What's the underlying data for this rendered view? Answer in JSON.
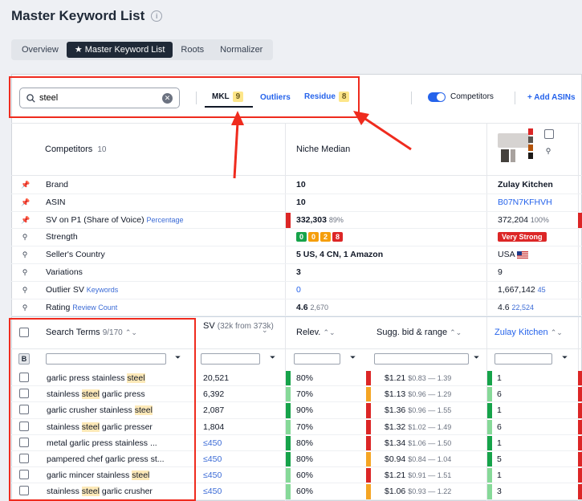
{
  "page": {
    "title": "Master Keyword List"
  },
  "tabs": [
    {
      "label": "Overview",
      "active": false
    },
    {
      "label": "Master Keyword List",
      "active": true
    },
    {
      "label": "Roots",
      "active": false
    },
    {
      "label": "Normalizer",
      "active": false
    }
  ],
  "toolbar": {
    "search_value": "steel",
    "segments": [
      {
        "label": "MKL",
        "count": "9"
      },
      {
        "label": "Outliers",
        "count": ""
      },
      {
        "label": "Residue",
        "count": "8"
      }
    ],
    "competitors_label": "Competitors",
    "competitors_on": true,
    "add_asins": "+ Add ASINs"
  },
  "competitors_header": {
    "label": "Competitors",
    "count": "10"
  },
  "niche_header": "Niche Median",
  "product": {
    "name": "Zulay Kitchen",
    "asin": "B07N7KFHVH"
  },
  "attributes": [
    {
      "label": "Brand",
      "sub": "",
      "niche": "10",
      "niche_sub": "",
      "product": "Zulay Kitchen",
      "product_sub": ""
    },
    {
      "label": "ASIN",
      "sub": "",
      "niche": "10",
      "niche_sub": "",
      "product": "B07N7KFHVH",
      "product_sub": ""
    },
    {
      "label": "SV on P1 (Share of Voice)",
      "sub": "Percentage",
      "niche": "332,303",
      "niche_sub": "89%",
      "product": "372,204",
      "product_sub": "100%"
    },
    {
      "label": "Strength",
      "sub": "",
      "niche": "",
      "niche_sub": "",
      "product": "Very Strong",
      "product_sub": ""
    },
    {
      "label": "Seller's Country",
      "sub": "",
      "niche": "5 US, 4 CN, 1 Amazon",
      "niche_sub": "",
      "product": "USA",
      "product_sub": ""
    },
    {
      "label": "Variations",
      "sub": "",
      "niche": "3",
      "niche_sub": "",
      "product": "9",
      "product_sub": ""
    },
    {
      "label": "Outlier SV",
      "sub": "Keywords",
      "niche": "0",
      "niche_sub": "",
      "product": "1,667,142",
      "product_sub": "45"
    },
    {
      "label": "Rating",
      "sub": "Review Count",
      "niche": "4.6",
      "niche_sub": "2,670",
      "product": "4.6",
      "product_sub": "22,524"
    }
  ],
  "strength_chips": [
    {
      "value": "0",
      "color": "#16a34a"
    },
    {
      "value": "0",
      "color": "#f59e0b"
    },
    {
      "value": "2",
      "color": "#f59e0b"
    },
    {
      "value": "8",
      "color": "#dc2626"
    }
  ],
  "table_header": {
    "search_terms": "Search Terms",
    "search_terms_count": "9/170",
    "sv": "SV",
    "sv_sub": "(32k from 373k)",
    "relev": "Relev.",
    "bid": "Sugg. bid & range",
    "product_col": "Zulay Kitchen",
    "b_label": "B"
  },
  "keywords": [
    {
      "pre": "garlic press stainless ",
      "hl": "steel",
      "post": "",
      "sv": "20,521",
      "relev": "80%",
      "bid": "$1.21",
      "range": "$0.83 — 1.39",
      "rank": "1",
      "relevColor": "#16a34a",
      "bidColor": "#dc2626",
      "rankColor": "#dc2626"
    },
    {
      "pre": "stainless ",
      "hl": "steel",
      "post": " garlic press",
      "sv": "6,392",
      "relev": "70%",
      "bid": "$1.13",
      "range": "$0.96 — 1.29",
      "rank": "6",
      "relevColor": "#86d998",
      "bidColor": "#f5a524",
      "rankColor": "#dc2626"
    },
    {
      "pre": "garlic crusher stainless ",
      "hl": "steel",
      "post": "",
      "sv": "2,087",
      "relev": "90%",
      "bid": "$1.36",
      "range": "$0.96 — 1.55",
      "rank": "1",
      "relevColor": "#16a34a",
      "bidColor": "#dc2626",
      "rankColor": "#dc2626"
    },
    {
      "pre": "stainless ",
      "hl": "steel",
      "post": " garlic presser",
      "sv": "1,804",
      "relev": "70%",
      "bid": "$1.32",
      "range": "$1.02 — 1.49",
      "rank": "6",
      "relevColor": "#86d998",
      "bidColor": "#dc2626",
      "rankColor": "#dc2626"
    },
    {
      "pre": "metal garlic press stainless ...",
      "hl": "",
      "post": "",
      "sv": "≤450",
      "relev": "80%",
      "bid": "$1.34",
      "range": "$1.06 — 1.50",
      "rank": "1",
      "relevColor": "#16a34a",
      "bidColor": "#dc2626",
      "rankColor": "#dc2626"
    },
    {
      "pre": "pampered chef garlic press st...",
      "hl": "",
      "post": "",
      "sv": "≤450",
      "relev": "80%",
      "bid": "$0.94",
      "range": "$0.84 — 1.04",
      "rank": "5",
      "relevColor": "#16a34a",
      "bidColor": "#f5a524",
      "rankColor": "#dc2626"
    },
    {
      "pre": "garlic mincer stainless ",
      "hl": "steel",
      "post": "",
      "sv": "≤450",
      "relev": "60%",
      "bid": "$1.21",
      "range": "$0.91 — 1.51",
      "rank": "1",
      "relevColor": "#86d998",
      "bidColor": "#dc2626",
      "rankColor": "#dc2626"
    },
    {
      "pre": "stainless ",
      "hl": "steel",
      "post": " garlic crusher",
      "sv": "≤450",
      "relev": "60%",
      "bid": "$1.06",
      "range": "$0.93 — 1.22",
      "rank": "3",
      "relevColor": "#86d998",
      "bidColor": "#f5a524",
      "rankColor": "#dc2626"
    }
  ]
}
